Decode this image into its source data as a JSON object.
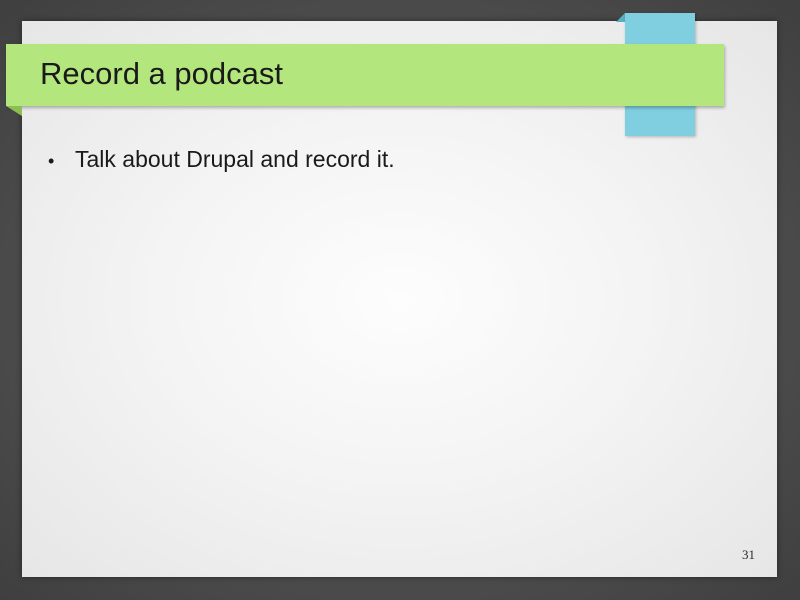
{
  "slide": {
    "title": "Record a podcast",
    "bullets": [
      {
        "marker": "•",
        "text": "Talk about Drupal and record it."
      }
    ],
    "page_number": "31"
  },
  "colors": {
    "title_band": "#b4e67e",
    "accent_tab": "#7fcfe0",
    "slide_background": "#f4f4f4",
    "outer_background": "#4a4a4a"
  }
}
